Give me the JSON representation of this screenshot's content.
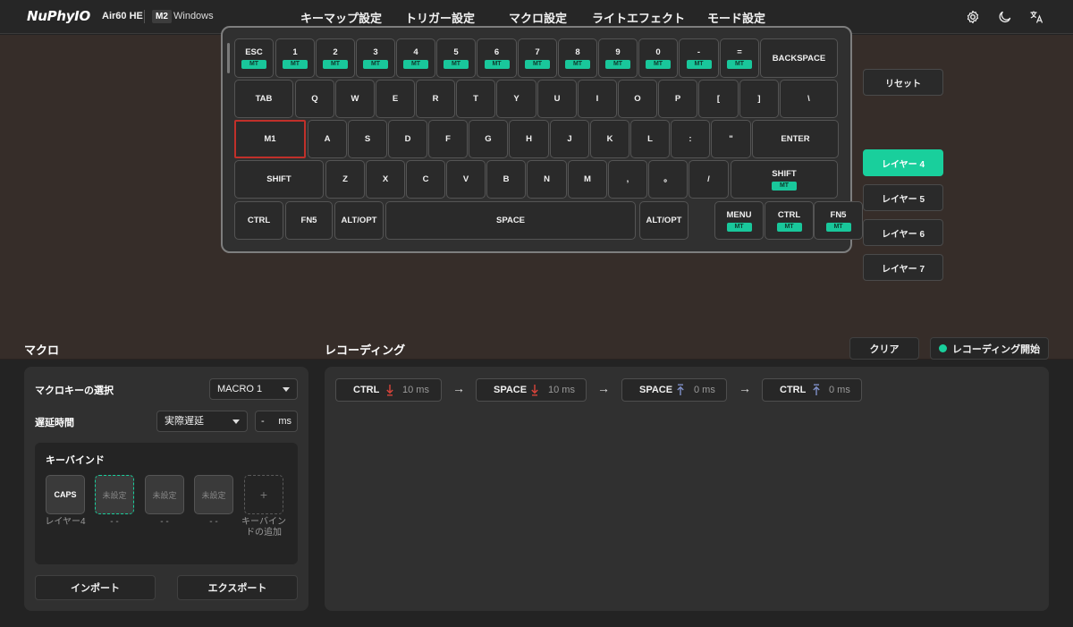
{
  "header": {
    "logo": "NuPhyIO",
    "device": "Air60 HE",
    "os_badge": "M2",
    "os_name": "Windows",
    "tabs": [
      {
        "label": "キーマップ設定"
      },
      {
        "label": "トリガー設定"
      },
      {
        "label": "マクロ設定",
        "active": true
      },
      {
        "label": "ライトエフェクト"
      },
      {
        "label": "モード設定"
      }
    ],
    "icons": [
      "gear-icon",
      "moon-icon",
      "translate-icon"
    ]
  },
  "keyboard": {
    "mt_label": "MT",
    "rows": [
      [
        {
          "l": "ESC",
          "mt": true
        },
        {
          "l": "1",
          "mt": true
        },
        {
          "l": "2",
          "mt": true
        },
        {
          "l": "3",
          "mt": true
        },
        {
          "l": "4",
          "mt": true
        },
        {
          "l": "5",
          "mt": true
        },
        {
          "l": "6",
          "mt": true
        },
        {
          "l": "7",
          "mt": true
        },
        {
          "l": "8",
          "mt": true
        },
        {
          "l": "9",
          "mt": true
        },
        {
          "l": "0",
          "mt": true
        },
        {
          "l": "-",
          "mt": true
        },
        {
          "l": "=",
          "mt": true
        },
        {
          "l": "BACKSPACE"
        }
      ],
      [
        {
          "l": "TAB"
        },
        {
          "l": "Q"
        },
        {
          "l": "W"
        },
        {
          "l": "E"
        },
        {
          "l": "R"
        },
        {
          "l": "T"
        },
        {
          "l": "Y"
        },
        {
          "l": "U"
        },
        {
          "l": "I"
        },
        {
          "l": "O"
        },
        {
          "l": "P"
        },
        {
          "l": "["
        },
        {
          "l": "]"
        },
        {
          "l": "\\"
        }
      ],
      [
        {
          "l": "M1",
          "selected": true
        },
        {
          "l": "A"
        },
        {
          "l": "S"
        },
        {
          "l": "D"
        },
        {
          "l": "F"
        },
        {
          "l": "G"
        },
        {
          "l": "H"
        },
        {
          "l": "J"
        },
        {
          "l": "K"
        },
        {
          "l": "L"
        },
        {
          "l": ":"
        },
        {
          "l": "\""
        },
        {
          "l": "ENTER"
        }
      ],
      [
        {
          "l": "SHIFT"
        },
        {
          "l": "Z"
        },
        {
          "l": "X"
        },
        {
          "l": "C"
        },
        {
          "l": "V"
        },
        {
          "l": "B"
        },
        {
          "l": "N"
        },
        {
          "l": "M"
        },
        {
          "l": ","
        },
        {
          "l": "。"
        },
        {
          "l": "/"
        },
        {
          "l": "SHIFT",
          "mt": true
        }
      ],
      [
        {
          "l": "CTRL"
        },
        {
          "l": "FN5"
        },
        {
          "l": "ALT/OPT"
        },
        {
          "l": "SPACE"
        },
        {
          "l": "ALT/OPT"
        },
        {
          "l": "MENU",
          "mt": true
        },
        {
          "l": "CTRL",
          "mt": true
        },
        {
          "l": "FN5",
          "mt": true
        }
      ]
    ]
  },
  "side": {
    "reset": "リセット",
    "layers": [
      {
        "label": "レイヤー 4",
        "active": true
      },
      {
        "label": "レイヤー 5"
      },
      {
        "label": "レイヤー 6"
      },
      {
        "label": "レイヤー 7"
      }
    ]
  },
  "macro": {
    "title": "マクロ",
    "select_label": "マクロキーの選択",
    "select_value": "MACRO 1",
    "delay_label": "遅延時間",
    "delay_mode": "実際遅延",
    "delay_value": "-",
    "delay_unit": "ms",
    "keybind_title": "キーバインド",
    "slots": [
      {
        "key": "CAPS",
        "caption": "レイヤー4"
      },
      {
        "key": "未設定",
        "caption": "- -"
      },
      {
        "key": "未設定",
        "caption": "- -"
      },
      {
        "key": "未設定",
        "caption": "- -"
      },
      {
        "key": "+",
        "caption": "キーバインドの追加"
      }
    ],
    "import": "インポート",
    "export": "エクスポート"
  },
  "recording": {
    "title": "レコーディング",
    "clear": "クリア",
    "start": "レコーディング開始",
    "events": [
      {
        "key": "CTRL",
        "dir": "down",
        "ms": "10 ms"
      },
      {
        "key": "SPACE",
        "dir": "down",
        "ms": "10 ms"
      },
      {
        "key": "SPACE",
        "dir": "up",
        "ms": "0 ms"
      },
      {
        "key": "CTRL",
        "dir": "up",
        "ms": "0 ms"
      }
    ],
    "arrow": "→"
  },
  "colors": {
    "accent": "#19cf9c",
    "down": "#d9443a",
    "up": "#7f90c8",
    "selected_outline": "#c0302a"
  }
}
